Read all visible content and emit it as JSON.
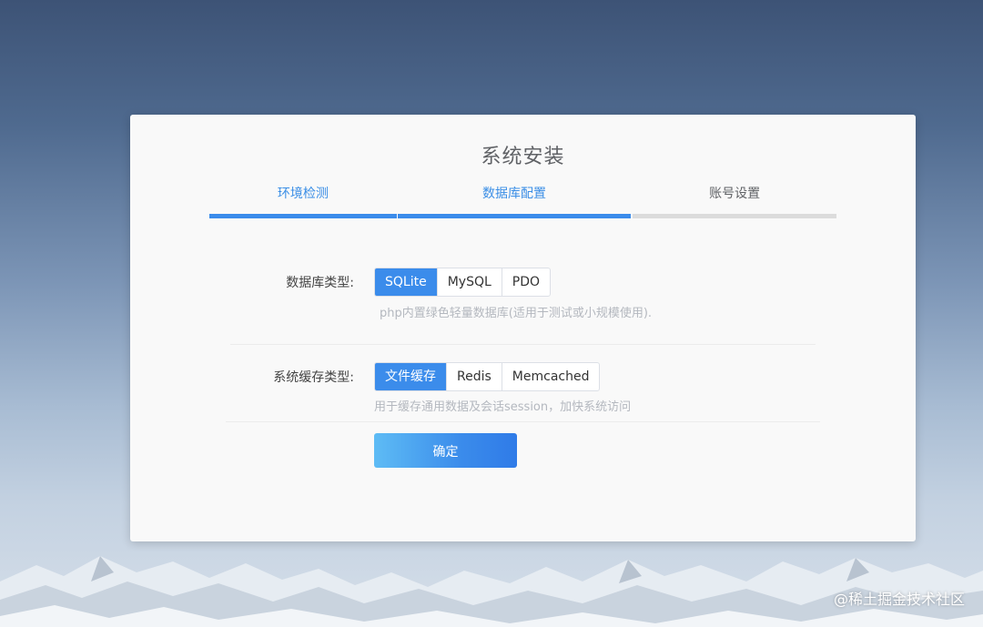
{
  "panel": {
    "title": "系统安装"
  },
  "steps": [
    {
      "label": "环境检测",
      "state": "done"
    },
    {
      "label": "数据库配置",
      "state": "current"
    },
    {
      "label": "账号设置",
      "state": "todo"
    }
  ],
  "database": {
    "label": "数据库类型:",
    "options": [
      "SQLite",
      "MySQL",
      "PDO"
    ],
    "selected": "SQLite",
    "hint": "php内置绿色轻量数据库(适用于测试或小规模使用)."
  },
  "cache": {
    "label": "系统缓存类型:",
    "options": [
      "文件缓存",
      "Redis",
      "Memcached"
    ],
    "selected": "文件缓存",
    "hint": "用于缓存通用数据及会话session，加快系统访问"
  },
  "confirm_label": "确定",
  "watermark": "@稀土掘金技术社区",
  "colors": {
    "accent": "#3b8ceb",
    "step_todo": "#dcdcdc"
  }
}
